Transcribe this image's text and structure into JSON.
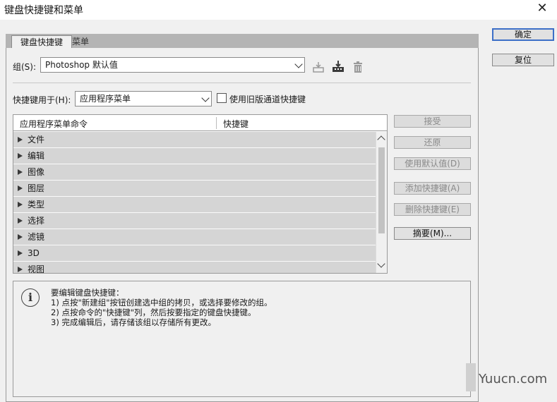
{
  "window": {
    "title": "键盘快捷键和菜单"
  },
  "tabs": [
    {
      "label": "键盘快捷键"
    },
    {
      "label": "菜单"
    }
  ],
  "group": {
    "label": "组(S):",
    "value": "Photoshop 默认值"
  },
  "shortcuts_for": {
    "label": "快捷键用于(H):",
    "value": "应用程序菜单"
  },
  "legacy_checkbox": {
    "label": "使用旧版通道快捷键",
    "checked": false
  },
  "table": {
    "columns": [
      "应用程序菜单命令",
      "快捷键"
    ],
    "rows": [
      "文件",
      "编辑",
      "图像",
      "图层",
      "类型",
      "选择",
      "滤镜",
      "3D",
      "视图"
    ]
  },
  "side_buttons": {
    "accept": "接受",
    "undo": "还原",
    "use_default": "使用默认值(D)",
    "add_shortcut": "添加快捷键(A)",
    "delete_shortcut": "删除快捷键(E)",
    "summarize": "摘要(M)..."
  },
  "info": {
    "heading": "要编辑键盘快捷键：",
    "steps": [
      "1) 点按\"新建组\"按钮创建选中组的拷贝，或选择要修改的组。",
      "2) 点按命令的\"快捷键\"列，然后按要指定的键盘快捷键。",
      "3) 完成编辑后，请存储该组以存储所有更改。"
    ]
  },
  "dialog_buttons": {
    "ok": "确定",
    "reset": "复位"
  },
  "watermark": "Yuucn.com",
  "icons": [
    "save-set-icon",
    "save-set-as-icon",
    "delete-set-icon",
    "info-icon",
    "close-icon"
  ]
}
